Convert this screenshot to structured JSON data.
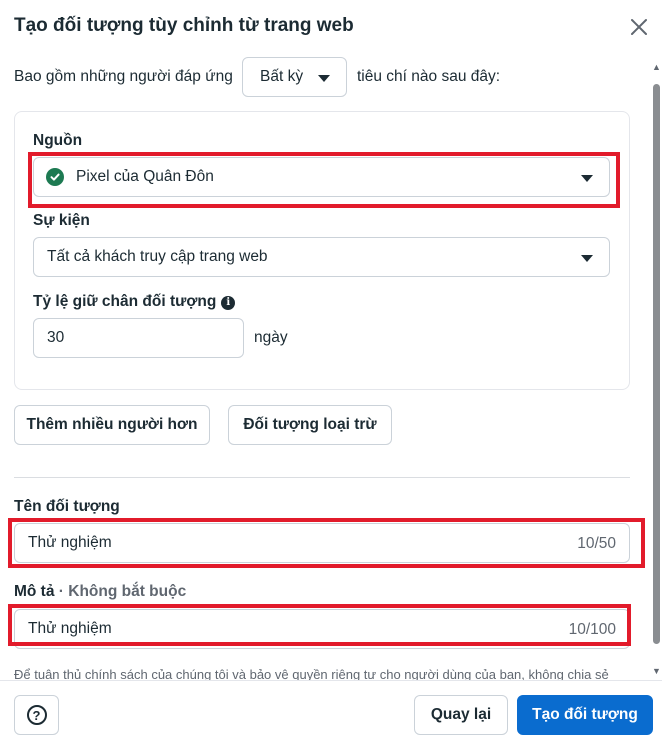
{
  "dialog": {
    "title": "Tạo đối tượng tùy chỉnh từ trang web"
  },
  "include": {
    "before": "Bao gồm những người đáp ứng",
    "selected": "Bất kỳ",
    "after": "tiêu chí nào sau đây:"
  },
  "source": {
    "label": "Nguồn",
    "value": "Pixel của Quân Đôn",
    "status_icon": "check-circle-icon"
  },
  "event": {
    "label": "Sự kiện",
    "value": "Tất cả khách truy cập trang web"
  },
  "retention": {
    "label": "Tỷ lệ giữ chân đối tượng",
    "value": "30",
    "unit": "ngày"
  },
  "actions": {
    "include_more": "Thêm nhiều người hơn",
    "exclude": "Đối tượng loại trừ"
  },
  "audience_name": {
    "label": "Tên đối tượng",
    "value": "Thử nghiệm",
    "counter": "10/50"
  },
  "description": {
    "label": "Mô tả",
    "optional": "· Không bắt buộc",
    "value": "Thử nghiệm",
    "counter": "10/100"
  },
  "notice": "Để tuân thủ chính sách của chúng tôi và bảo vệ quyền riêng tư cho người dùng của bạn, không chia sẻ",
  "footer": {
    "back": "Quay lại",
    "create": "Tạo đối tượng"
  },
  "colors": {
    "primary": "#0a6ccf",
    "highlight": "#e21b2b",
    "success": "#1d7a52"
  }
}
